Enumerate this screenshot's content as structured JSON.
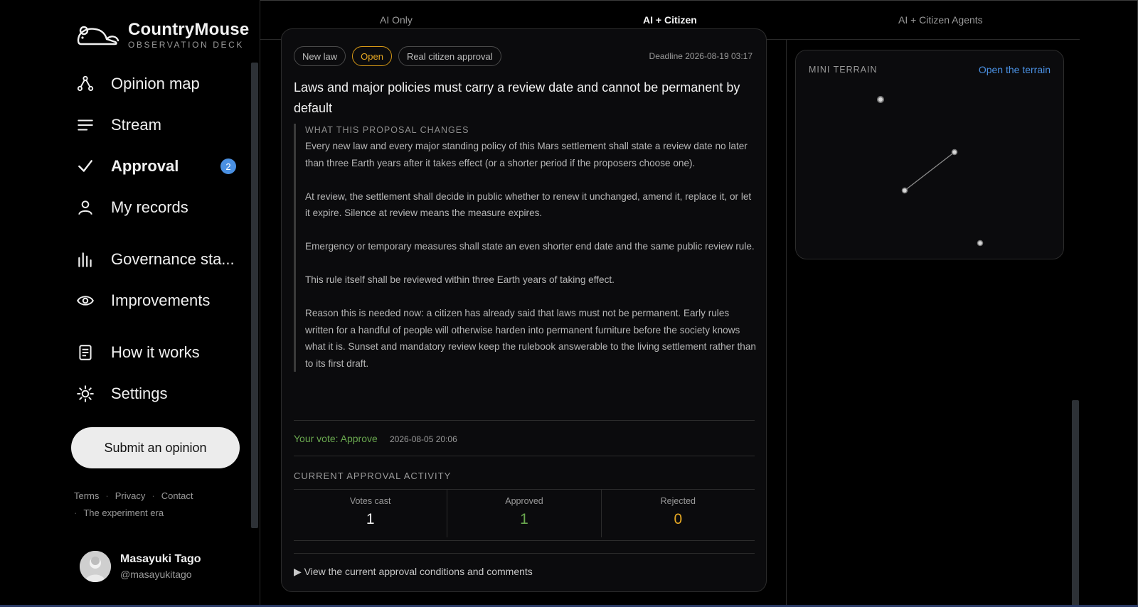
{
  "brand": {
    "name": "CountryMouse",
    "subtitle": "OBSERVATION DECK"
  },
  "nav": {
    "opinion_map": "Opinion map",
    "stream": "Stream",
    "approval": "Approval",
    "approval_badge": "2",
    "my_records": "My records",
    "governance": "Governance sta...",
    "improvements": "Improvements",
    "how_it_works": "How it works",
    "settings": "Settings"
  },
  "submit_label": "Submit an opinion",
  "footer": {
    "terms": "Terms",
    "privacy": "Privacy",
    "contact": "Contact",
    "era": "The experiment era"
  },
  "user": {
    "name": "Masayuki Tago",
    "handle": "@masayukitago"
  },
  "tabs": {
    "ai_only": "AI Only",
    "ai_citizen": "AI + Citizen",
    "ai_citizen_agents": "AI + Citizen Agents",
    "active": "AI + Citizen"
  },
  "proposal": {
    "tags": [
      "New law",
      "Open",
      "Real citizen approval"
    ],
    "deadline": "Deadline 2026-08-19 03:17",
    "title": "Laws and major policies must carry a review date and cannot be permanent by default",
    "changes_heading": "WHAT THIS PROPOSAL CHANGES",
    "paragraphs": [
      "Every new law and every major standing policy of this Mars settlement shall state a review date no later than three Earth years after it takes effect (or a shorter period if the proposers choose one).",
      "At review, the settlement shall decide in public whether to renew it unchanged, amend it, replace it, or let it expire. Silence at review means the measure expires.",
      "Emergency or temporary measures shall state an even shorter end date and the same public review rule.",
      "This rule itself shall be reviewed within three Earth years of taking effect.",
      "Reason this is needed now: a citizen has already said that laws must not be permanent. Early rules written for a handful of people will otherwise harden into permanent furniture before the society knows what it is. Sunset and mandatory review keep the rulebook answerable to the living settlement rather than to its first draft."
    ],
    "your_vote": "Your vote: Approve",
    "vote_time": "2026-08-05 20:06",
    "activity_heading": "CURRENT APPROVAL ACTIVITY",
    "stats": {
      "votes_label": "Votes cast",
      "votes_value": "1",
      "approved_label": "Approved",
      "approved_value": "1",
      "rejected_label": "Rejected",
      "rejected_value": "0"
    },
    "details": "▶ View the current approval conditions and comments"
  },
  "mini_terrain": {
    "title": "MINI TERRAIN",
    "link": "Open the terrain"
  },
  "colors": {
    "accent": "#4a90e2",
    "open_tag": "#e6a823",
    "approve": "#6aa84f"
  }
}
